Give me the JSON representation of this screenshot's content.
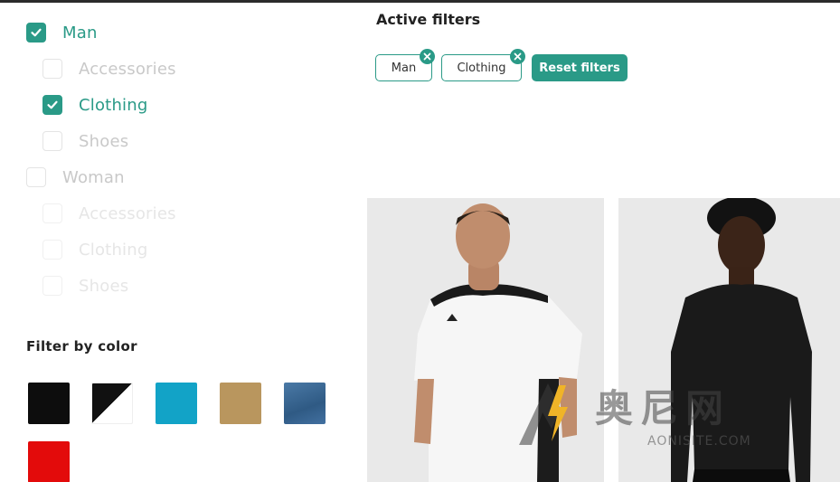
{
  "categories": [
    {
      "label": "Man",
      "checked": true
    },
    {
      "label": "Accessories",
      "checked": false
    },
    {
      "label": "Clothing",
      "checked": true
    },
    {
      "label": "Shoes",
      "checked": false
    },
    {
      "label": "Woman",
      "checked": false
    },
    {
      "label": "Accessories",
      "checked": false
    },
    {
      "label": "Clothing",
      "checked": false
    },
    {
      "label": "Shoes",
      "checked": false
    }
  ],
  "color_filter": {
    "title": "Filter by color",
    "swatches": [
      {
        "name": "black",
        "color": "#0d0d0d"
      },
      {
        "name": "black-white",
        "color": "#111111"
      },
      {
        "name": "blue",
        "color": "#12a3c7"
      },
      {
        "name": "beige",
        "color": "#b9965e"
      },
      {
        "name": "denim",
        "color": "#3d6a96"
      },
      {
        "name": "red",
        "color": "#e30b0b"
      }
    ]
  },
  "active_filters": {
    "title": "Active filters",
    "chips": [
      "Man",
      "Clothing"
    ],
    "reset_label": "Reset filters"
  },
  "products": [
    {
      "name": "white-tshirt"
    },
    {
      "name": "black-sweater"
    }
  ],
  "watermark": {
    "text": "奥尼网",
    "subtext": "AONISITE.COM"
  },
  "colors": {
    "accent": "#2a9a87"
  }
}
